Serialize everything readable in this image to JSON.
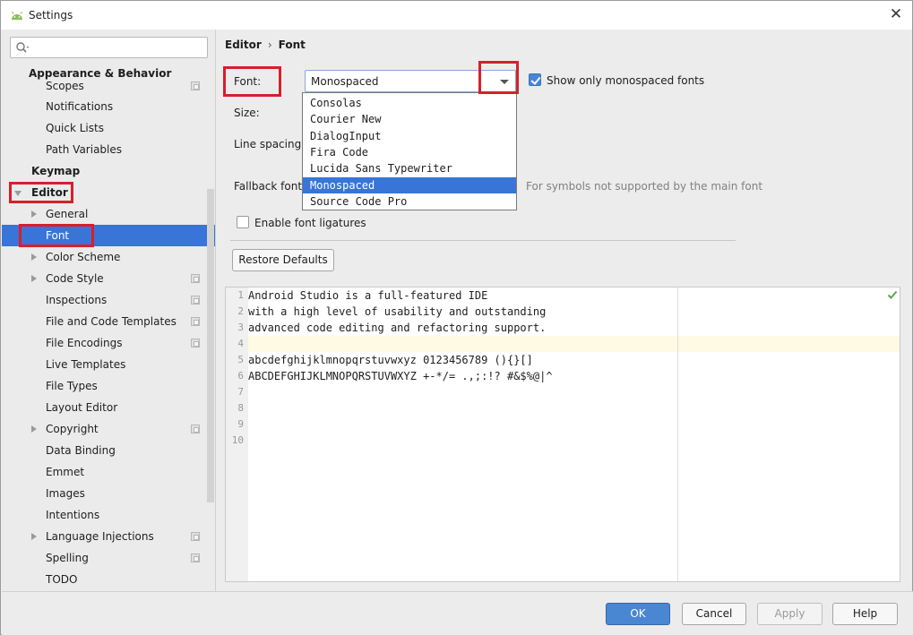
{
  "window": {
    "title": "Settings"
  },
  "search": {
    "placeholder": ""
  },
  "sidebar": {
    "items": [
      {
        "label": "Appearance & Behavior"
      },
      {
        "label": "Scopes"
      },
      {
        "label": "Notifications"
      },
      {
        "label": "Quick Lists"
      },
      {
        "label": "Path Variables"
      },
      {
        "label": "Keymap"
      },
      {
        "label": "Editor"
      },
      {
        "label": "General"
      },
      {
        "label": "Font"
      },
      {
        "label": "Color Scheme"
      },
      {
        "label": "Code Style"
      },
      {
        "label": "Inspections"
      },
      {
        "label": "File and Code Templates"
      },
      {
        "label": "File Encodings"
      },
      {
        "label": "Live Templates"
      },
      {
        "label": "File Types"
      },
      {
        "label": "Layout Editor"
      },
      {
        "label": "Copyright"
      },
      {
        "label": "Data Binding"
      },
      {
        "label": "Emmet"
      },
      {
        "label": "Images"
      },
      {
        "label": "Intentions"
      },
      {
        "label": "Language Injections"
      },
      {
        "label": "Spelling"
      },
      {
        "label": "TODO"
      }
    ]
  },
  "breadcrumb": {
    "parent": "Editor",
    "separator": "›",
    "current": "Font"
  },
  "form": {
    "font_label": "Font:",
    "font_value": "Monospaced",
    "show_mono_label": "Show only monospaced fonts",
    "show_mono_checked": true,
    "size_label": "Size:",
    "line_spacing_label": "Line spacing:",
    "fallback_label": "Fallback font:",
    "fallback_hint": "For symbols not supported by the main font",
    "ligatures_label": "Enable font ligatures",
    "ligatures_checked": false,
    "restore_defaults": "Restore Defaults"
  },
  "font_dropdown": {
    "options": [
      "Consolas",
      "Courier New",
      "DialogInput",
      "Fira Code",
      "Lucida Sans Typewriter",
      "Monospaced",
      "Source Code Pro"
    ],
    "selected": "Monospaced"
  },
  "preview": {
    "line_numbers": [
      "1",
      "2",
      "3",
      "4",
      "5",
      "6",
      "7",
      "8",
      "9",
      "10"
    ],
    "lines": [
      "Android Studio is a full-featured IDE",
      "with a high level of usability and outstanding",
      "advanced code editing and refactoring support.",
      "",
      "abcdefghijklmnopqrstuvwxyz 0123456789 (){}[]",
      "ABCDEFGHIJKLMNOPQRSTUVWXYZ +-*/= .,;:!? #&$%@|^",
      "",
      "",
      "",
      ""
    ]
  },
  "footer": {
    "ok": "OK",
    "cancel": "Cancel",
    "apply": "Apply",
    "help": "Help"
  },
  "colors": {
    "selection": "#3875d7",
    "highlight": "#d5202a",
    "caret_row": "#fffae3",
    "primary_button": "#4a87d2"
  }
}
